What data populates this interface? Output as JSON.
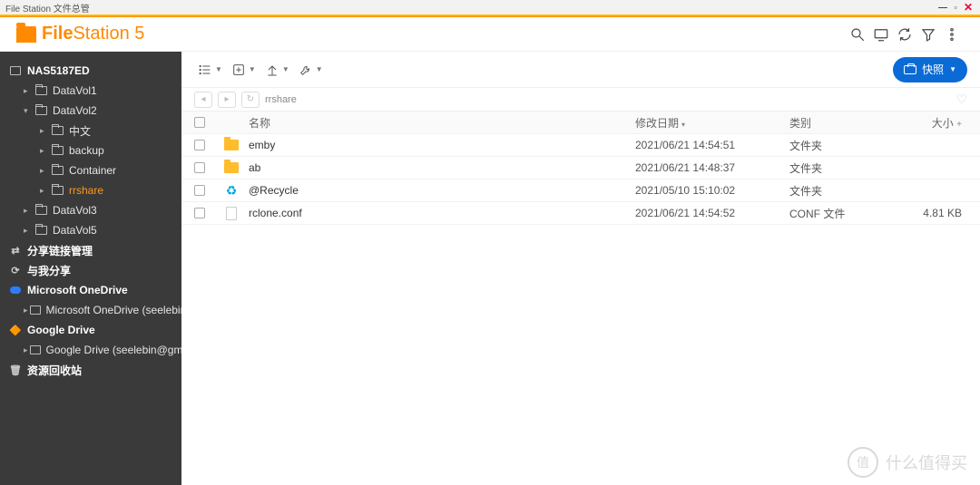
{
  "window": {
    "title": "File Station 文件总管"
  },
  "app": {
    "name_bold": "File",
    "name_thin": "Station 5"
  },
  "header_icons": [
    "search",
    "monitor",
    "refresh",
    "filter",
    "more"
  ],
  "toolbar": {
    "view_mode": "list",
    "snapshot_label": "快照"
  },
  "breadcrumb": {
    "path": "rrshare"
  },
  "sidebar": {
    "root": "NAS5187ED",
    "tree": [
      {
        "label": "DataVol1",
        "level": 2,
        "expandable": true
      },
      {
        "label": "DataVol2",
        "level": 2,
        "expandable": true,
        "expanded": true
      },
      {
        "label": "中文",
        "level": 3,
        "expandable": true
      },
      {
        "label": "backup",
        "level": 3,
        "expandable": true
      },
      {
        "label": "Container",
        "level": 3,
        "expandable": true
      },
      {
        "label": "rrshare",
        "level": 3,
        "expandable": true,
        "selected": true
      },
      {
        "label": "DataVol3",
        "level": 2,
        "expandable": true
      },
      {
        "label": "DataVol5",
        "level": 2,
        "expandable": true
      }
    ],
    "share_mgmt": "分享链接管理",
    "shared_with_me": "与我分享",
    "onedrive": "Microsoft OneDrive",
    "onedrive_acct": "Microsoft OneDrive (seelebin@",
    "gdrive": "Google Drive",
    "gdrive_acct": "Google Drive (seelebin@gmail.",
    "recycle": "资源回收站"
  },
  "columns": {
    "name": "名称",
    "date": "修改日期",
    "type": "类别",
    "size": "大小"
  },
  "rows": [
    {
      "icon": "folder",
      "name": "emby",
      "date": "2021/06/21 14:54:51",
      "type": "文件夹",
      "size": ""
    },
    {
      "icon": "folder",
      "name": "ab",
      "date": "2021/06/21 14:48:37",
      "type": "文件夹",
      "size": ""
    },
    {
      "icon": "recycle",
      "name": "@Recycle",
      "date": "2021/05/10 15:10:02",
      "type": "文件夹",
      "size": ""
    },
    {
      "icon": "file",
      "name": "rclone.conf",
      "date": "2021/06/21 14:54:52",
      "type": "CONF 文件",
      "size": "4.81 KB"
    }
  ],
  "watermark": {
    "badge": "值",
    "text": "什么值得买"
  }
}
